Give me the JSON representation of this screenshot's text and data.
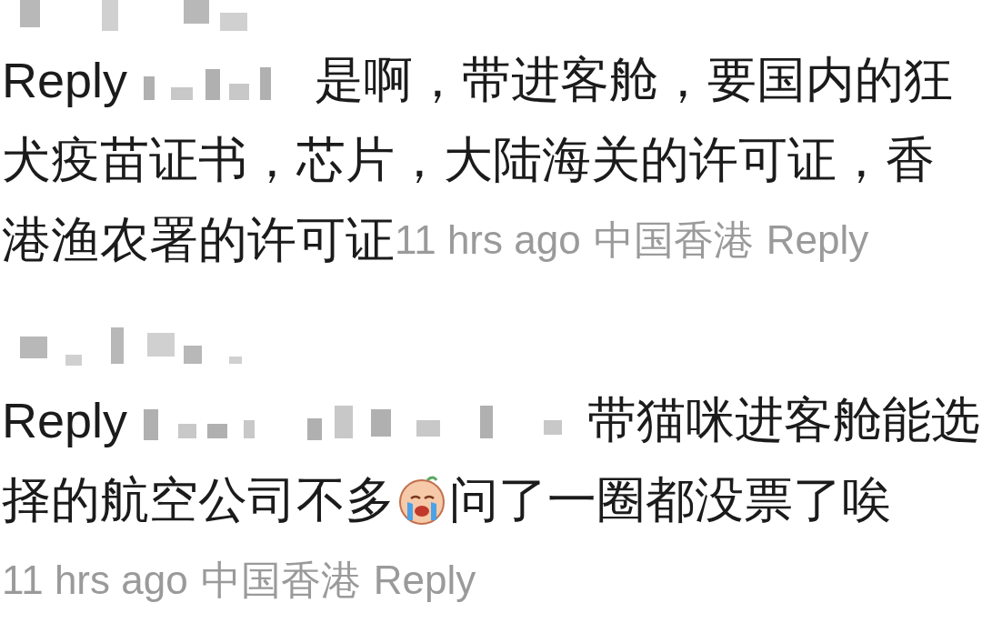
{
  "comments": [
    {
      "lines": [
        [
          {
            "kind": "prefix",
            "text": "Reply"
          },
          {
            "kind": "redacted"
          },
          {
            "kind": "text",
            "text": "是啊，带进客舱，要国内的狂"
          }
        ],
        [
          {
            "kind": "text",
            "text": "犬疫苗证书，芯片，大陆海关的许可证，香"
          }
        ],
        [
          {
            "kind": "text",
            "text": "港渔农署的许可证"
          },
          {
            "kind": "time",
            "text": "11 hrs ago"
          },
          {
            "kind": "location",
            "text": "中国香港"
          },
          {
            "kind": "reply",
            "text": "Reply"
          }
        ]
      ]
    },
    {
      "lines": [
        [
          {
            "kind": "prefix",
            "text": "Reply"
          },
          {
            "kind": "redacted"
          },
          {
            "kind": "text",
            "text": "带猫咪进客舱能选"
          }
        ],
        [
          {
            "kind": "text",
            "text": "择的航空公司不多"
          },
          {
            "kind": "emoji"
          },
          {
            "kind": "text",
            "text": "问了一圈都没票了唉"
          }
        ],
        [
          {
            "kind": "time",
            "text": "11 hrs ago"
          },
          {
            "kind": "location",
            "text": "中国香港"
          },
          {
            "kind": "reply",
            "text": "Reply"
          }
        ]
      ]
    }
  ]
}
